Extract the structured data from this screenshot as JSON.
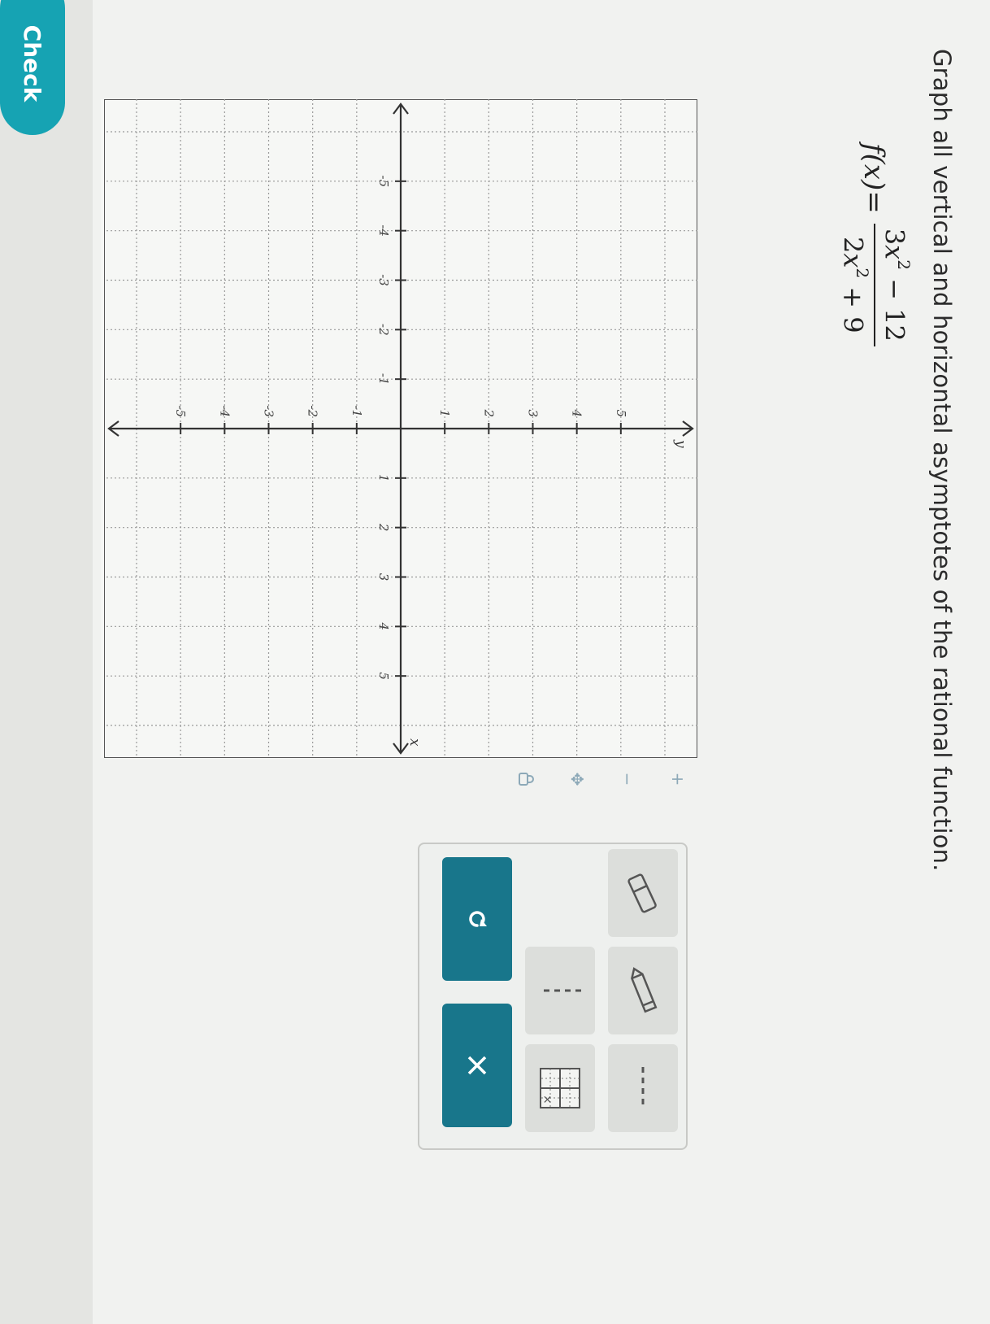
{
  "question": "Graph all vertical and horizontal asymptotes of the rational function.",
  "formula": {
    "lhs_func": "f",
    "lhs_var": "(x)",
    "equals": "=",
    "num_a": "3",
    "num_var": "x",
    "num_exp": "2",
    "num_rest": " − 12",
    "den_a": "2",
    "den_var": "x",
    "den_exp": "2",
    "den_rest": " + 9"
  },
  "graph": {
    "x_axis_label": "x",
    "y_axis_label": "y",
    "x_range": [
      -5,
      5
    ],
    "y_range": [
      -5,
      5
    ],
    "x_ticks": [
      "-5",
      "-4",
      "-3",
      "-2",
      "-1",
      "1",
      "2",
      "3",
      "4",
      "5"
    ],
    "y_ticks": [
      "5",
      "4",
      "3",
      "2",
      "1",
      "-1",
      "-2",
      "-3",
      "-4",
      "-5"
    ]
  },
  "graph_tools": [
    {
      "name": "zoom-in-icon",
      "glyph": "+"
    },
    {
      "name": "zoom-out-icon",
      "glyph": "−"
    },
    {
      "name": "move-icon",
      "glyph": "✥"
    },
    {
      "name": "lock-icon",
      "glyph": "🔒"
    }
  ],
  "check_label": "Check",
  "colors": {
    "accent": "#18768b",
    "check": "#16a3b3"
  }
}
